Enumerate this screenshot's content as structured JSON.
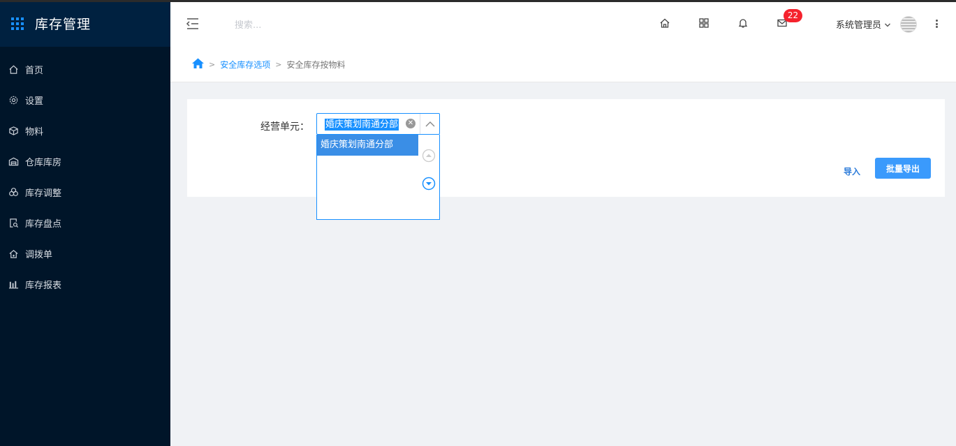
{
  "app": {
    "title": "库存管理"
  },
  "sidebar": {
    "items": [
      {
        "label": "首页",
        "icon": "home-icon"
      },
      {
        "label": "设置",
        "icon": "gear-icon"
      },
      {
        "label": "物料",
        "icon": "box-icon"
      },
      {
        "label": "仓库库房",
        "icon": "warehouse-icon"
      },
      {
        "label": "库存调整",
        "icon": "adjust-icon"
      },
      {
        "label": "库存盘点",
        "icon": "inventory-check-icon"
      },
      {
        "label": "调拨单",
        "icon": "transfer-icon"
      },
      {
        "label": "库存报表",
        "icon": "bar-chart-icon"
      }
    ]
  },
  "header": {
    "search_placeholder": "搜索...",
    "mail_badge": "22",
    "user_name": "系统管理员"
  },
  "breadcrumb": {
    "items": [
      "安全库存选项",
      "安全库存按物料"
    ],
    "separator": ">"
  },
  "form": {
    "label": "经营单元：",
    "selected_value": "婚庆策划南通分部",
    "options": [
      "婚庆策划南通分部"
    ]
  },
  "actions": {
    "import_label": "导入",
    "export_label": "批量导出"
  },
  "colors": {
    "accent": "#1890ff",
    "sidebar_bg": "#001529",
    "badge": "#f5222d"
  }
}
